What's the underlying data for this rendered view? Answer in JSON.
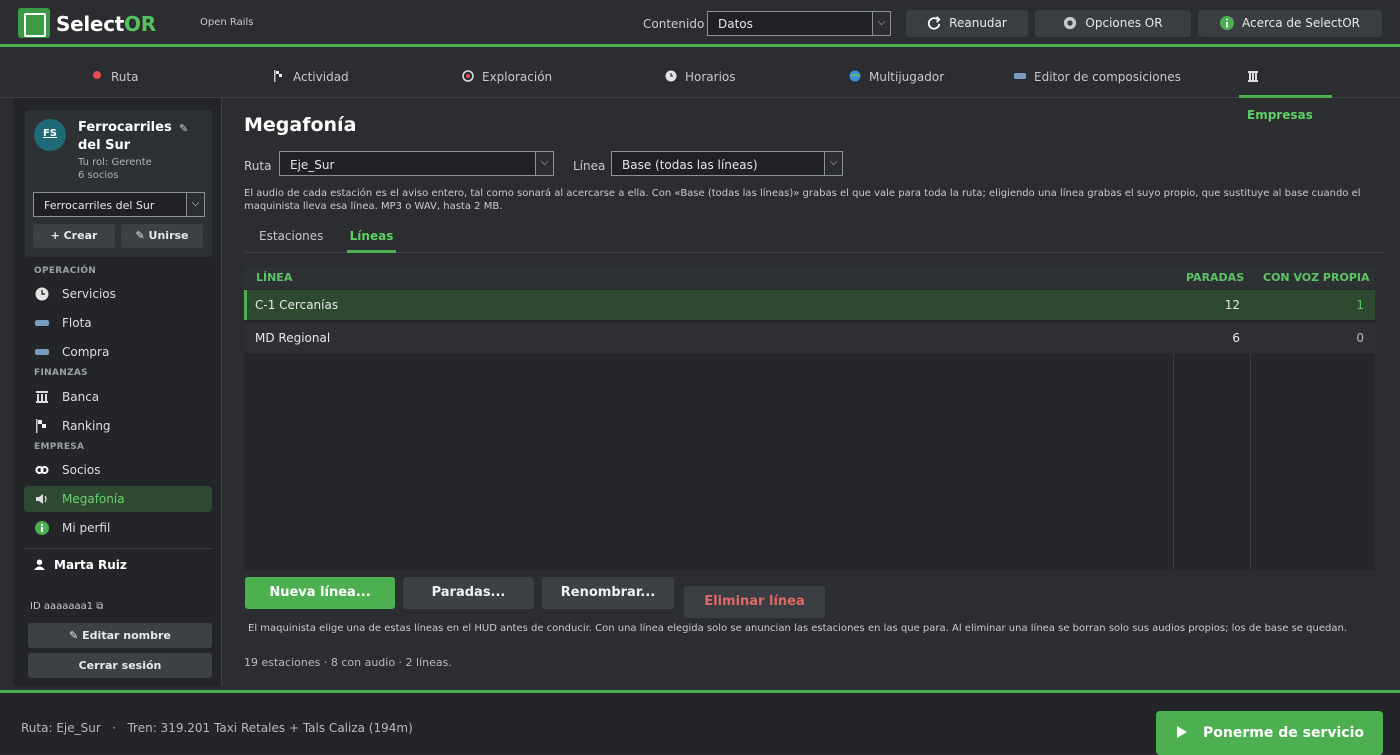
{
  "app": {
    "name_main": "Select",
    "name_accent": "OR",
    "subtitle": "Open Rails"
  },
  "topbar": {
    "contenido_label": "Contenido",
    "contenido_value": "Datos",
    "buttons": {
      "reanudar": "Reanudar",
      "opciones": "Opciones OR",
      "acerca": "Acerca de SelectOR"
    }
  },
  "nav": {
    "tabs": [
      {
        "label": "Ruta",
        "icon": "map-pin-icon"
      },
      {
        "label": "Actividad",
        "icon": "checkered-flag-icon"
      },
      {
        "label": "Exploración",
        "icon": "compass-icon"
      },
      {
        "label": "Horarios",
        "icon": "clock-icon"
      },
      {
        "label": "Multijugador",
        "icon": "globe-icon"
      },
      {
        "label": "Editor de composiciones",
        "icon": "train-icon"
      },
      {
        "label": "Empresas",
        "icon": "building-icon",
        "active": true
      }
    ]
  },
  "sidebar": {
    "company": {
      "avatar": "FS",
      "name": "Ferrocarriles del Sur",
      "rol": "Tu rol: Gerente",
      "socios": "6 socios",
      "select_value": "Ferrocarriles del Sur"
    },
    "crear_label": "Crear",
    "unirse_label": "Unirse",
    "sections": {
      "operacion": "OPERACIÓN",
      "finanzas": "FINANZAS",
      "empresa": "EMPRESA"
    },
    "items": {
      "servicios": "Servicios",
      "flota": "Flota",
      "compra": "Compra",
      "banca": "Banca",
      "ranking": "Ranking",
      "socios": "Socios",
      "megafonia": "Megafonía",
      "perfil": "Mi perfil"
    },
    "user_name": "Marta Ruiz",
    "user_id": "ID aaaaaaa1",
    "editar_label": "Editar nombre",
    "cerrar_label": "Cerrar sesión"
  },
  "main": {
    "title": "Megafonía",
    "ruta_label": "Ruta",
    "ruta_value": "Eje_Sur",
    "linea_label": "Línea",
    "linea_value": "Base (todas las líneas)",
    "description": "El audio de cada estación es el aviso entero, tal como sonará al acercarse a ella. Con «Base (todas las líneas)» grabas el que vale para toda la ruta; eligiendo una línea grabas el suyo propio, que sustituye al base cuando el maquinista lleva esa línea. MP3 o WAV, hasta 2 MB.",
    "subtabs": [
      "Estaciones",
      "Líneas"
    ],
    "table": {
      "headers": {
        "linea": "LÍNEA",
        "paradas": "PARADAS",
        "voz": "CON VOZ PROPIA"
      },
      "rows": [
        {
          "linea": "C-1 Cercanías",
          "paradas": "12",
          "voz": "1"
        },
        {
          "linea": "MD Regional",
          "paradas": "6",
          "voz": "0"
        }
      ]
    },
    "actions": {
      "nueva": "Nueva línea...",
      "paradas": "Paradas...",
      "renombrar": "Renombrar...",
      "eliminar": "Eliminar línea"
    },
    "note": "El maquinista elige una de estas líneas en el HUD antes de conducir. Con una línea elegida solo se anuncian las estaciones en las que para. Al eliminar una línea se borran solo sus audios propios; los de base se quedan.",
    "summary": "19 estaciones · 8 con audio · 2 líneas."
  },
  "bottom": {
    "route_info": "Ruta: Eje_Sur   ·   Tren: 319.201 Taxi Retales + Tals Caliza (194m)",
    "servicio_label": "Ponerme de servicio"
  },
  "colors": {
    "accent": "#4caf50",
    "accent_text": "#5dd366",
    "danger": "#e06a6a",
    "bg": "#2b2d30"
  }
}
